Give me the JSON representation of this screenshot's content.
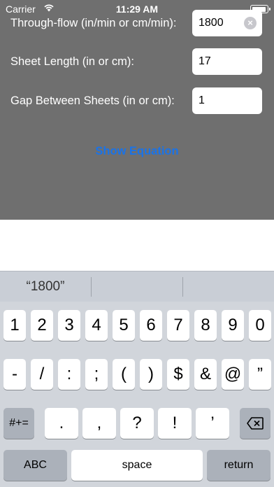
{
  "status_bar": {
    "carrier": "Carrier",
    "time": "11:29 AM"
  },
  "form": {
    "through_flow": {
      "label": "Through-flow (in/min or cm/min):",
      "value": "1800"
    },
    "sheet_length": {
      "label": "Sheet Length (in or cm):",
      "value": "17"
    },
    "gap": {
      "label": "Gap Between Sheets (in or cm):",
      "value": "1"
    },
    "show_equation": "Show Equation"
  },
  "keyboard": {
    "suggestion": "“1800”",
    "row1": [
      "1",
      "2",
      "3",
      "4",
      "5",
      "6",
      "7",
      "8",
      "9",
      "0"
    ],
    "row2": [
      "-",
      "/",
      ":",
      ";",
      "(",
      ")",
      "$",
      "&",
      "@",
      "”"
    ],
    "row3": [
      ".",
      ",",
      "?",
      "!",
      "’"
    ],
    "mode_key": "#+=",
    "abc": "ABC",
    "space": "space",
    "return": "return"
  }
}
